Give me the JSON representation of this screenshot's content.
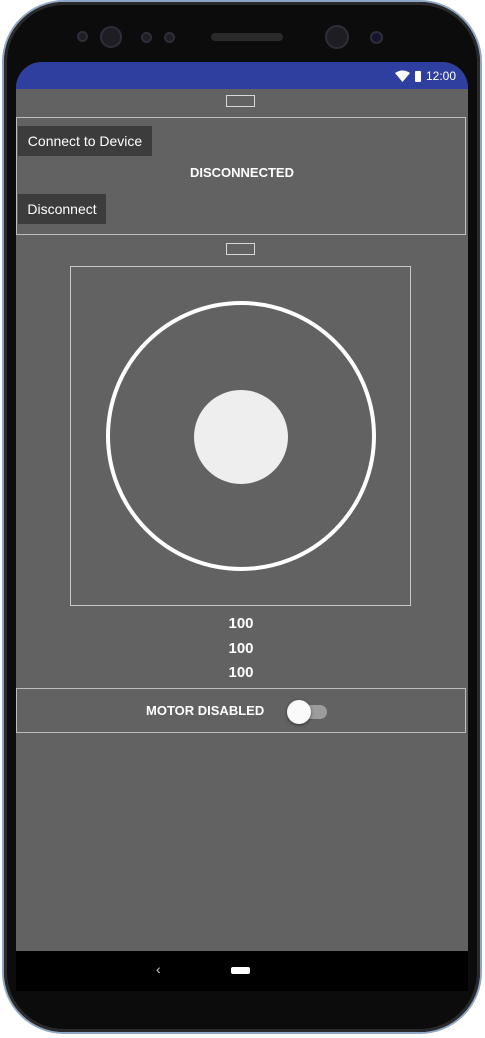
{
  "status_bar": {
    "time": "12:00",
    "icons": [
      "wifi-icon",
      "battery-icon"
    ],
    "color": "#2f3fa0"
  },
  "connection": {
    "connect_label": "Connect to Device",
    "status": "DISCONNECTED",
    "disconnect_label": "Disconnect"
  },
  "joystick": {
    "ring_color": "#ffffff",
    "knob_color": "#eeeeee"
  },
  "readouts": [
    "100",
    "100",
    "100"
  ],
  "motor": {
    "label": "MOTOR DISABLED",
    "enabled": false
  },
  "nav": {
    "back_icon": "‹"
  },
  "colors": {
    "screen_bg": "#626262",
    "button_bg": "#3c3c3c"
  }
}
